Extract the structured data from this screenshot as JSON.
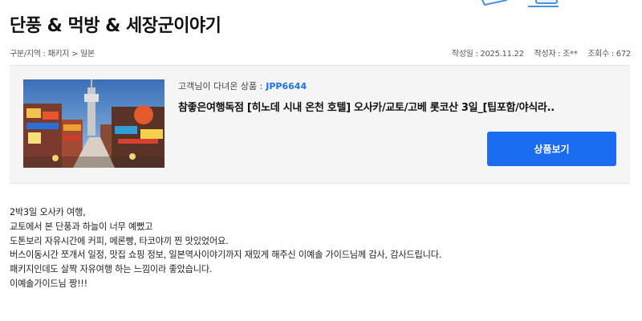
{
  "post": {
    "title": "단풍 & 먹방 & 세장군이야기",
    "breadcrumb": "구분/지역 : 패키지 > 일본",
    "date": "작성일 : 2025.11.22",
    "author": "작성자 : 조**",
    "views": "조회수 : 672"
  },
  "product": {
    "visited_label": "고객님이 다녀온 상품 :",
    "code": "JPP6644",
    "name": "참좋은여행독점 [히노데 시내 온천 호텔] 오사카/교토/고베 롯코산 3일_[팁포함/야식라..",
    "button_label": "상품보기"
  },
  "body": {
    "lines": [
      "2박3일 오사카 여행,",
      "교토에서 본 단풍과 하늘이 너무 예뻤고",
      "도톤보리 자유시간에  커피, 메론빵, 타코야끼 찐 맛있었어요.",
      "버스이동시간 쪼개서 일정, 맛집 쇼핑 정보, 일본역사이야기까지 재밌게 해주신 이예솔 가이드님께 감사, 감사드립니다.",
      "패키지인데도 살짝 자유여행 하는 느낌이라 좋았습니다.",
      "이예솔가이드님 짱!!!"
    ]
  },
  "colors": {
    "accent": "#1a6df0",
    "code": "#1a73e8",
    "panel": "#f5f5f5"
  },
  "icons": {
    "decoration": "laptop-icon",
    "thumbnail": "osaka-street-photo"
  }
}
